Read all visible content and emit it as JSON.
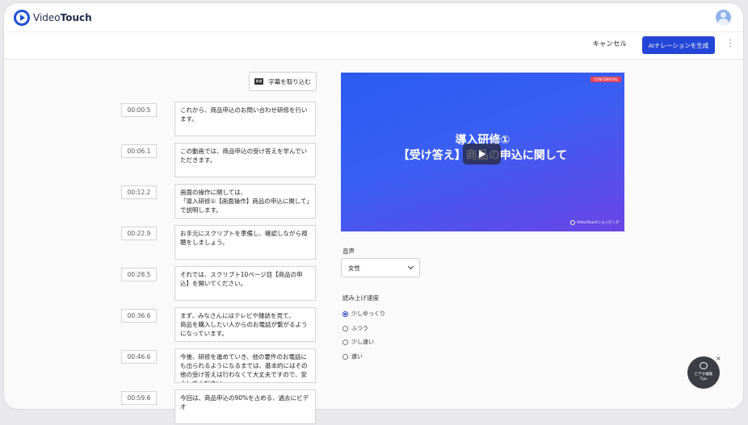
{
  "app": {
    "logo_regular": "Video",
    "logo_bold": "Touch"
  },
  "actions": {
    "cancel_label": "キャンセル",
    "generate_label": "AIナレーションを生成"
  },
  "import_button_label": "字幕を取り込む",
  "subtitles": [
    {
      "time": "00:00.5",
      "text": "これから、商品申込のお問い合わせ研修を行います。"
    },
    {
      "time": "00:06.1",
      "text": "この動画では、商品申込の受け答えを学んでいただきます。"
    },
    {
      "time": "00:12.2",
      "text": "画面の操作に関しては、\n「導入研修①【画面操作】商品の申込に関して」で説明します。"
    },
    {
      "time": "00:22.9",
      "text": "お手元にスクリプトを準備し、確認しながら視聴をしましょう。"
    },
    {
      "time": "00:28.5",
      "text": "それでは、スクリプト10ページ目【商品の申込】を開いてください。"
    },
    {
      "time": "00:36.6",
      "text": "まず、みなさんにはテレビや雑誌を見て、\n商品を購入したい人からのお電話が繋がるようになっています。"
    },
    {
      "time": "00:46.6",
      "text": "今後、研修を進めていき、他の要件のお電話にも出られるようになるまでは、基本的にはその他の受け答えは行わなくて大丈夫ですので、安心してください。"
    },
    {
      "time": "00:59.6",
      "text": "今回は、商品申込の90%を占める、過去にビデオ"
    }
  ],
  "video": {
    "badge": "CONFIDENTIAL",
    "title_line1": "導入研修①",
    "title_line2": "【受け答え】商品の申込に関して",
    "brand": "VideoTouchショッピング"
  },
  "voice": {
    "label": "音声",
    "selected": "女性"
  },
  "speed": {
    "label": "読み上げ速度",
    "options": [
      "少しゆっくり",
      "ふつう",
      "少し速い",
      "速い"
    ],
    "selected_index": 0
  },
  "tips": {
    "line1": "ビデオ編集",
    "line2": "Tips",
    "close": "×"
  }
}
